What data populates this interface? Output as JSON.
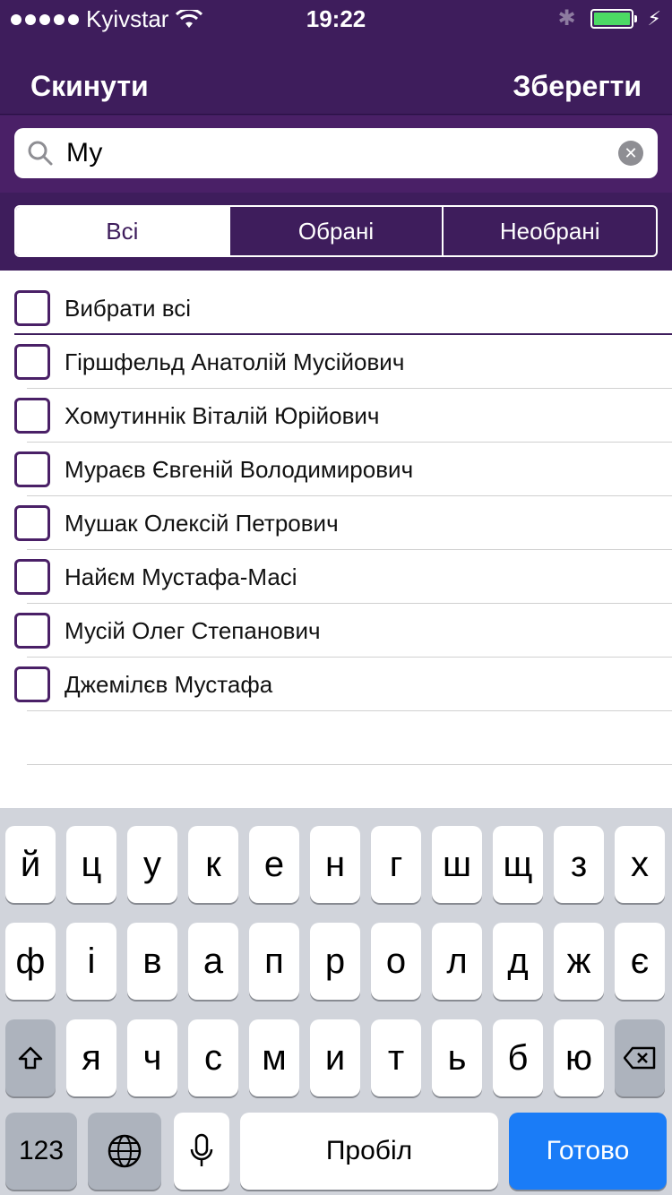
{
  "status_bar": {
    "carrier": "Kyivstar",
    "time": "19:22",
    "signal_dots": 5,
    "battery_level": 1.0
  },
  "nav": {
    "reset_label": "Скинути",
    "save_label": "Зберегти"
  },
  "search": {
    "value": "Му"
  },
  "segments": [
    {
      "label": "Всі",
      "selected": true
    },
    {
      "label": "Обрані",
      "selected": false
    },
    {
      "label": "Необрані",
      "selected": false
    }
  ],
  "list": {
    "select_all_label": "Вибрати всі",
    "items": [
      {
        "name": "Гіршфельд Анатолій Мусійович",
        "checked": false
      },
      {
        "name": "Хомутиннік Віталій Юрійович",
        "checked": false
      },
      {
        "name": "Мураєв Євгеній Володимирович",
        "checked": false
      },
      {
        "name": "Мушак Олексій Петрович",
        "checked": false
      },
      {
        "name": "Найєм Мустафа-Масі",
        "checked": false
      },
      {
        "name": "Мусій Олег Степанович",
        "checked": false
      },
      {
        "name": "Джемілєв Мустафа",
        "checked": false
      }
    ]
  },
  "keyboard": {
    "row1": [
      "й",
      "ц",
      "у",
      "к",
      "е",
      "н",
      "г",
      "ш",
      "щ",
      "з",
      "х"
    ],
    "row2": [
      "ф",
      "і",
      "в",
      "а",
      "п",
      "р",
      "о",
      "л",
      "д",
      "ж",
      "є"
    ],
    "row3": [
      "я",
      "ч",
      "с",
      "м",
      "и",
      "т",
      "ь",
      "б",
      "ю"
    ],
    "numbers_label": "123",
    "space_label": "Пробіл",
    "done_label": "Готово"
  },
  "colors": {
    "header_bg": "#3e1d5c",
    "accent_blue": "#1a7cf7",
    "battery_green": "#4cd964"
  }
}
